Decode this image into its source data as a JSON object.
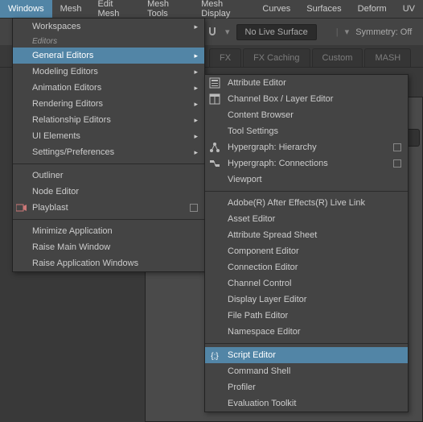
{
  "menubar": {
    "items": [
      "Windows",
      "Mesh",
      "Edit Mesh",
      "Mesh Tools",
      "Mesh Display",
      "Curves",
      "Surfaces",
      "Deform",
      "UV"
    ],
    "active_index": 0
  },
  "toolbar": {
    "live_surface": "No Live Surface",
    "symmetry": "Symmetry: Off"
  },
  "shelf_tabs": [
    "FX",
    "FX Caching",
    "Custom",
    "MASH"
  ],
  "menu1": {
    "header_workspaces": "Workspaces",
    "header_editors": "Editors",
    "items_group1": [
      {
        "label": "General Editors",
        "arrow": true,
        "hi": true
      },
      {
        "label": "Modeling Editors",
        "arrow": true
      },
      {
        "label": "Animation Editors",
        "arrow": true
      },
      {
        "label": "Rendering Editors",
        "arrow": true
      },
      {
        "label": "Relationship Editors",
        "arrow": true
      },
      {
        "label": "UI Elements",
        "arrow": true
      },
      {
        "label": "Settings/Preferences",
        "arrow": true
      }
    ],
    "items_group2": [
      {
        "label": "Outliner"
      },
      {
        "label": "Node Editor"
      },
      {
        "label": "Playblast",
        "box": true,
        "left_icon": true
      }
    ],
    "items_group3": [
      {
        "label": "Minimize Application"
      },
      {
        "label": "Raise Main Window"
      },
      {
        "label": "Raise Application Windows"
      }
    ]
  },
  "menu2": {
    "items_g1": [
      {
        "label": "Attribute Editor",
        "icon": "attr"
      },
      {
        "label": "Channel Box / Layer Editor",
        "icon": "chan"
      },
      {
        "label": "Content Browser"
      },
      {
        "label": "Tool Settings"
      },
      {
        "label": "Hypergraph: Hierarchy",
        "icon": "hg",
        "rbox": true
      },
      {
        "label": "Hypergraph: Connections",
        "icon": "hg",
        "rbox": true
      },
      {
        "label": "Viewport"
      }
    ],
    "items_g2": [
      {
        "label": "Adobe(R) After Effects(R) Live Link"
      },
      {
        "label": "Asset Editor"
      },
      {
        "label": "Attribute Spread Sheet"
      },
      {
        "label": "Component Editor"
      },
      {
        "label": "Connection Editor"
      },
      {
        "label": "Channel Control"
      },
      {
        "label": "Display Layer Editor"
      },
      {
        "label": "File Path Editor"
      },
      {
        "label": "Namespace Editor"
      }
    ],
    "items_g3": [
      {
        "label": "Script Editor",
        "icon": "script",
        "hi": true
      },
      {
        "label": "Command Shell"
      },
      {
        "label": "Profiler"
      },
      {
        "label": "Evaluation Toolkit"
      }
    ]
  }
}
